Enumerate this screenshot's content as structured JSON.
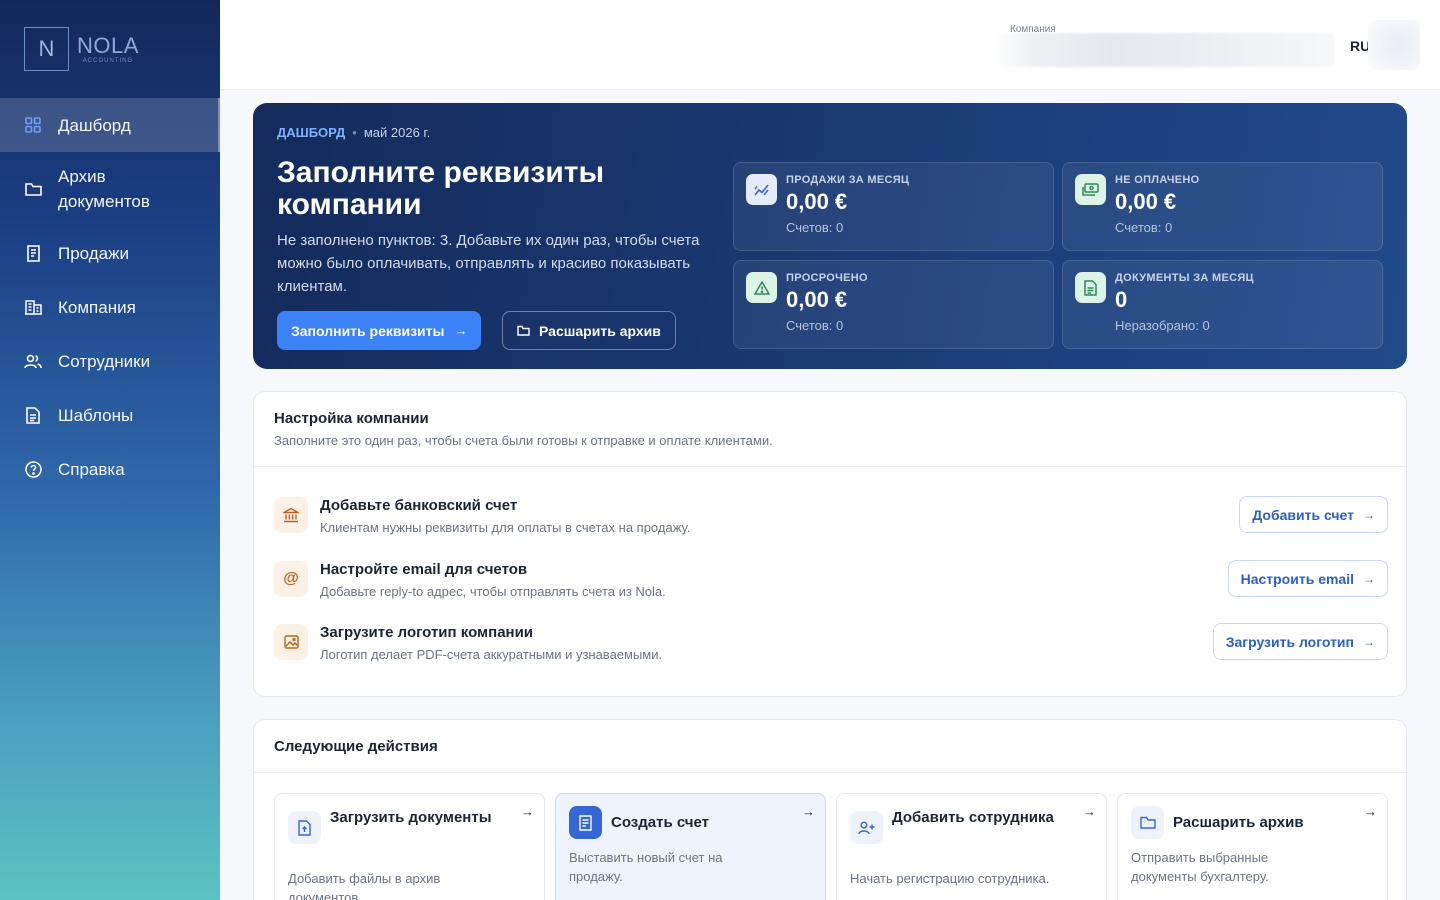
{
  "brand": {
    "name": "NOLA",
    "tagline": "ACCOUNTING",
    "mark": "N"
  },
  "sidebar": {
    "items": [
      {
        "label": "Дашборд",
        "icon": "dashboard-icon"
      },
      {
        "label": "Архив документов",
        "icon": "folder-icon"
      },
      {
        "label": "Продажи",
        "icon": "receipt-icon"
      },
      {
        "label": "Компания",
        "icon": "building-icon"
      },
      {
        "label": "Сотрудники",
        "icon": "users-icon"
      },
      {
        "label": "Шаблоны",
        "icon": "document-icon"
      },
      {
        "label": "Справка",
        "icon": "help-icon"
      }
    ]
  },
  "header": {
    "company_label": "Компания",
    "language": "RU"
  },
  "hero": {
    "breadcrumb": "ДАШБОРД",
    "period": "май 2026 г.",
    "title": "Заполните реквизиты компании",
    "description": "Не заполнено пунктов: 3. Добавьте их один раз, чтобы счета можно было оплачивать, отправлять и красиво показывать клиентам.",
    "primary_button": "Заполнить реквизиты",
    "secondary_button": "Расшарить архив",
    "stats": [
      {
        "label": "ПРОДАЖИ ЗА МЕСЯЦ",
        "value": "0,00 €",
        "sub": "Счетов: 0",
        "icon": "trend-icon"
      },
      {
        "label": "НЕ ОПЛАЧЕНО",
        "value": "0,00 €",
        "sub": "Счетов: 0",
        "icon": "banknote-icon"
      },
      {
        "label": "ПРОСРОЧЕНО",
        "value": "0,00 €",
        "sub": "Счетов: 0",
        "icon": "warning-icon"
      },
      {
        "label": "ДОКУМЕНТЫ ЗА МЕСЯЦ",
        "value": "0",
        "sub": "Неразобрано: 0",
        "icon": "document-icon"
      }
    ]
  },
  "setup": {
    "title": "Настройка компании",
    "subtitle": "Заполните это один раз, чтобы счета были готовы к отправке и оплате клиентами.",
    "tasks": [
      {
        "title": "Добавьте банковский счет",
        "description": "Клиентам нужны реквизиты для оплаты в счетах на продажу.",
        "button": "Добавить счет",
        "icon": "bank-icon"
      },
      {
        "title": "Настройте email для счетов",
        "description": "Добавьте reply-to адрес, чтобы отправлять счета из Nola.",
        "button": "Настроить email",
        "icon": "at-icon"
      },
      {
        "title": "Загрузите логотип компании",
        "description": "Логотип делает PDF-счета аккуратными и узнаваемыми.",
        "button": "Загрузить логотип",
        "icon": "image-icon"
      }
    ]
  },
  "next": {
    "title": "Следующие действия",
    "actions": [
      {
        "title": "Загрузить документы",
        "description": "Добавить файлы в архив документов.",
        "icon": "upload-icon"
      },
      {
        "title": "Создать счет",
        "description": "Выставить новый счет на продажу.",
        "icon": "invoice-icon"
      },
      {
        "title": "Добавить сотрудника",
        "description": "Начать регистрацию сотрудника.",
        "icon": "user-plus-icon"
      },
      {
        "title": "Расшарить архив",
        "description": "Отправить выбранные документы бухгалтеру.",
        "icon": "folder-icon"
      }
    ]
  },
  "colors": {
    "accent": "#3b82f6",
    "hero_bg": "#1a3a74",
    "link": "#2b5fc7",
    "warm_icon_bg": "#fdf1e6"
  }
}
